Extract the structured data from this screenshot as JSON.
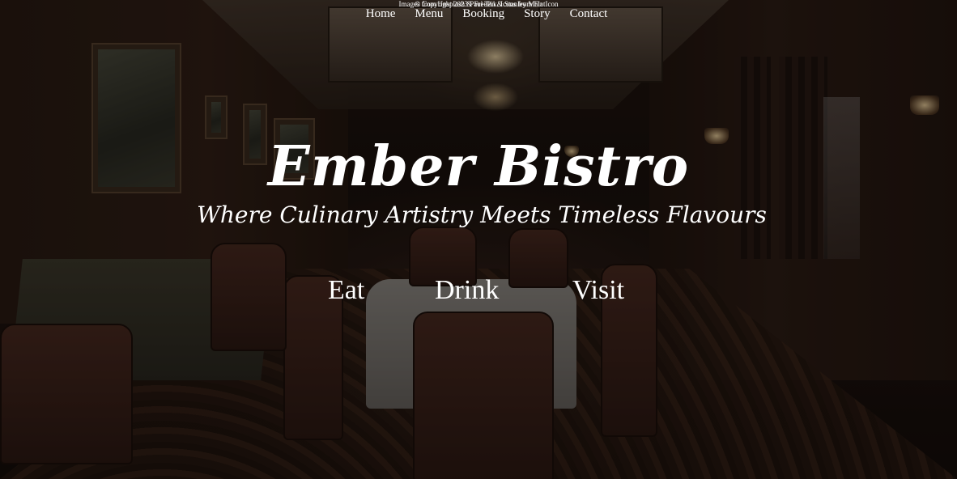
{
  "nav": {
    "items": [
      {
        "label": "Home"
      },
      {
        "label": "Menu"
      },
      {
        "label": "Booking"
      },
      {
        "label": "Story"
      },
      {
        "label": "Contact"
      }
    ]
  },
  "hero": {
    "title": "Ember Bistro",
    "tagline": "Where Culinary Artistry Meets Timeless Flavours"
  },
  "sections": {
    "eat": "Eat",
    "drink": "Drink",
    "visit": "Visit"
  },
  "footer": {
    "credits": "Images from Unsplash & FreePik. Icons from FlatIcon",
    "copyright": "© Copyright 2023 Paul Tan & Stanley Mair"
  },
  "colors": {
    "text": "#ffffff",
    "background": "#1a110c"
  },
  "background": {
    "icon": "restaurant-interior-photo"
  }
}
